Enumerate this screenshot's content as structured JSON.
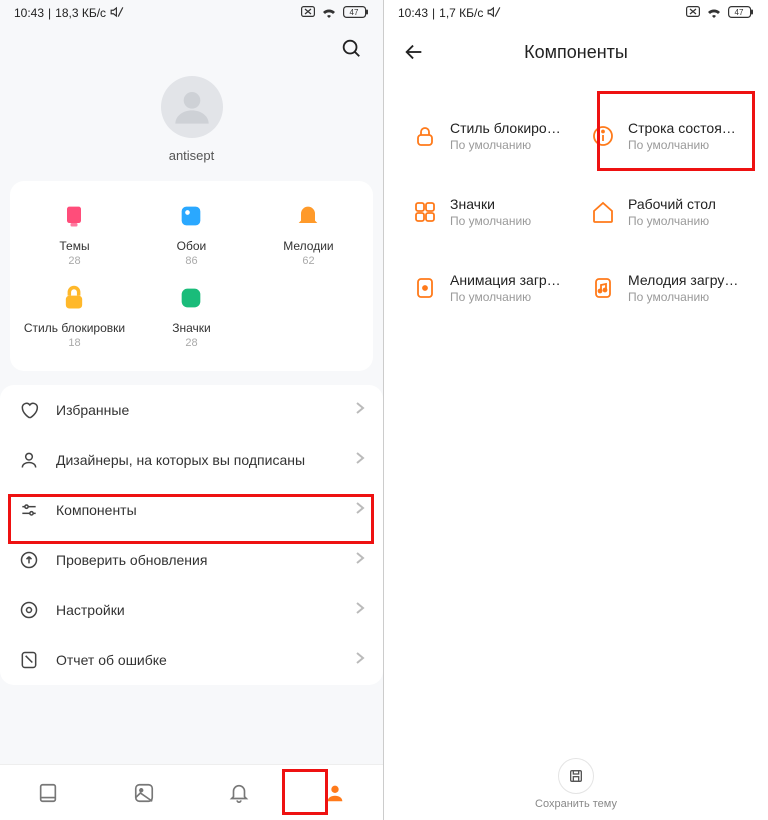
{
  "left": {
    "status": {
      "time": "10:43",
      "net": "18,3 КБ/с"
    },
    "username": "antisept",
    "grid": [
      {
        "label": "Темы",
        "count": "28",
        "icon": "themes"
      },
      {
        "label": "Обои",
        "count": "86",
        "icon": "wallpaper"
      },
      {
        "label": "Мелодии",
        "count": "62",
        "icon": "ringtone"
      },
      {
        "label": "Стиль блокировки",
        "count": "18",
        "icon": "lock"
      },
      {
        "label": "Значки",
        "count": "28",
        "icon": "icons"
      }
    ],
    "menu": [
      {
        "label": "Избранные",
        "icon": "heart"
      },
      {
        "label": "Дизайнеры, на которых вы подписаны",
        "icon": "person"
      },
      {
        "label": "Компоненты",
        "icon": "sliders",
        "highlight": true
      },
      {
        "label": "Проверить обновления",
        "icon": "update"
      },
      {
        "label": "Настройки",
        "icon": "gear"
      },
      {
        "label": "Отчет об ошибке",
        "icon": "report"
      }
    ]
  },
  "right": {
    "status": {
      "time": "10:43",
      "net": "1,7 КБ/с"
    },
    "title": "Компоненты",
    "default_text": "По умолчанию",
    "components": [
      {
        "title": "Стиль блокировки",
        "icon": "lock"
      },
      {
        "title": "Строка состояния",
        "icon": "info",
        "highlight": true
      },
      {
        "title": "Значки",
        "icon": "grid"
      },
      {
        "title": "Рабочий стол",
        "icon": "home"
      },
      {
        "title": "Анимация загрузки",
        "icon": "boot"
      },
      {
        "title": "Мелодия загрузки",
        "icon": "music"
      }
    ],
    "save_label": "Сохранить тему"
  },
  "battery": "47"
}
